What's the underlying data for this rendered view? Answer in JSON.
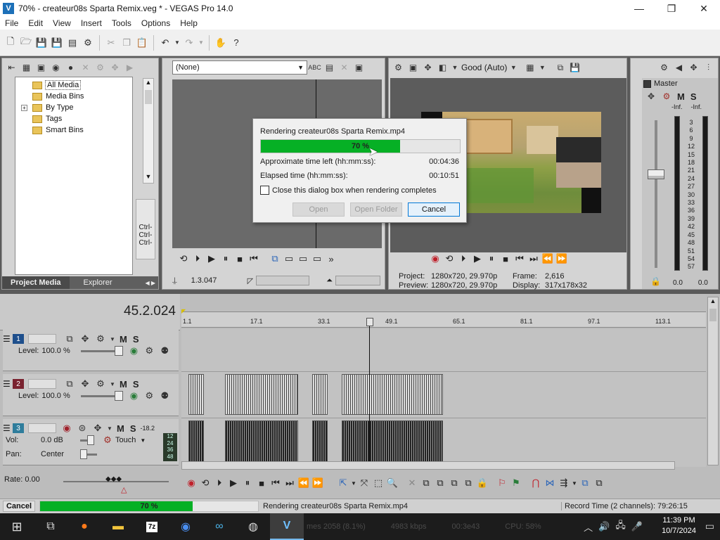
{
  "window": {
    "title": "70% - createur08s Sparta Remix.veg * - VEGAS Pro 14.0",
    "app_icon": "vegas-logo-icon",
    "minimize": "—",
    "maximize": "❐",
    "close": "✕"
  },
  "menu": [
    "File",
    "Edit",
    "View",
    "Insert",
    "Tools",
    "Options",
    "Help"
  ],
  "project_media": {
    "tree": [
      "All Media",
      "Media Bins",
      "By Type",
      "Tags",
      "Smart Bins"
    ],
    "expand_symbol": "+",
    "shortcuts": [
      "Ctrl-",
      "Ctrl-",
      "Ctrl-"
    ],
    "tabs": [
      "Project Media",
      "Explorer"
    ]
  },
  "trimmer": {
    "dropdown_value": "(None)",
    "timecode": "1.3.047"
  },
  "preview": {
    "quality": "Good (Auto)",
    "project_label": "Project:",
    "project_value": "1280x720, 29.970p",
    "preview_label": "Preview:",
    "preview_value": "1280x720, 29.970p",
    "frame_label": "Frame:",
    "frame_value": "2,616",
    "display_label": "Display:",
    "display_value": "317x178x32"
  },
  "mixer": {
    "master_label": "Master",
    "inf_left": "-Inf.",
    "inf_right": "-Inf.",
    "scale": [
      "3",
      "6",
      "9",
      "12",
      "15",
      "18",
      "21",
      "24",
      "27",
      "30",
      "33",
      "36",
      "39",
      "42",
      "45",
      "48",
      "51",
      "54",
      "57"
    ],
    "bottom_left": "0.0",
    "bottom_right": "0.0"
  },
  "render_dialog": {
    "title": "Rendering createur08s Sparta Remix.mp4",
    "progress_percent": 70,
    "progress_text": "70 %",
    "time_left_label": "Approximate time left (hh:mm:ss):",
    "time_left_value": "00:04:36",
    "elapsed_label": "Elapsed time (hh:mm:ss):",
    "elapsed_value": "00:10:51",
    "checkbox_label": "Close this dialog box when rendering completes",
    "btn_open": "Open",
    "btn_open_folder": "Open Folder",
    "btn_cancel": "Cancel"
  },
  "timeline": {
    "cursor_time": "45.2.024",
    "ruler_marks": [
      "1.1",
      "17.1",
      "33.1",
      "49.1",
      "65.1",
      "81.1",
      "97.1",
      "113.1"
    ],
    "tracks": [
      {
        "num": "1",
        "color": "#1e4f8c",
        "level_label": "Level:",
        "level_value": "100.0 %"
      },
      {
        "num": "2",
        "color": "#7a2330",
        "level_label": "Level:",
        "level_value": "100.0 %"
      }
    ],
    "audio_track": {
      "num": "3",
      "vol_label": "Vol:",
      "vol_value": "0.0 dB",
      "pan_label": "Pan:",
      "pan_value": "Center",
      "touch_label": "Touch",
      "meter_values": [
        "-18.2",
        "12",
        "24",
        "36",
        "48"
      ]
    },
    "m_label": "M",
    "s_label": "S",
    "rate_label": "Rate: 0.00"
  },
  "statusbar": {
    "cancel_label": "Cancel",
    "progress_percent": 70,
    "progress_text": "70 %",
    "message": "Rendering createur08s Sparta Remix.mp4",
    "record_time": "Record Time (2 channels): 79:26:15"
  },
  "taskbar": {
    "time": "11:39 PM",
    "date": "10/7/2024",
    "bg_text": [
      "mes 2058 (8.1%)",
      "4983 kbps",
      "00:3e43",
      "CPU: 58%"
    ]
  },
  "colors": {
    "accent_green": "#06b025",
    "track1": "#1e4f8c",
    "track2": "#7a2330",
    "track3": "#2f7d9c"
  }
}
